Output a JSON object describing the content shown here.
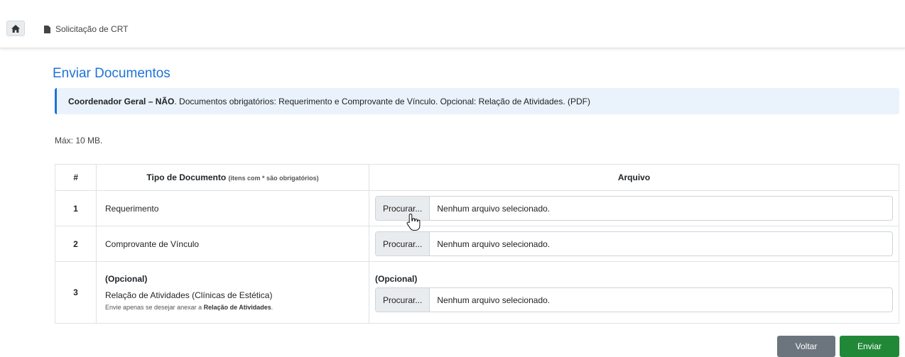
{
  "breadcrumb": {
    "current": "Solicitação de CRT"
  },
  "page": {
    "title": "Enviar Documentos"
  },
  "alert": {
    "bold": "Coordenador Geral – NÃO",
    "text": ". Documentos obrigatórios: Requerimento e Comprovante de Vínculo. Opcional: Relação de Atividades. (PDF)"
  },
  "max_note": "Máx: 10 MB.",
  "table": {
    "headers": {
      "num": "#",
      "type": "Tipo de Documento",
      "type_hint": "(itens com * são obrigatórios)",
      "file": "Arquivo"
    },
    "rows": [
      {
        "num": "1",
        "type": "Requerimento",
        "browse": "Procurar...",
        "file_status": "Nenhum arquivo selecionado."
      },
      {
        "num": "2",
        "type": "Comprovante de Vínculo",
        "browse": "Procurar...",
        "file_status": "Nenhum arquivo selecionado."
      },
      {
        "num": "3",
        "optional_tag": "(Opcional)",
        "type": "Relação de Atividades (Clínicas de Estética)",
        "help_prefix": "Envie apenas se desejar anexar a ",
        "help_bold": "Relação de Atividades",
        "help_suffix": ".",
        "file_optional_tag": "(Opcional)",
        "browse": "Procurar...",
        "file_status": "Nenhum arquivo selecionado."
      }
    ]
  },
  "actions": {
    "back": "Voltar",
    "send": "Enviar"
  },
  "colors": {
    "accent": "#1e73d8",
    "send": "#218838",
    "back": "#6c757d",
    "alert_bg": "#eaf3fc"
  },
  "icons": {
    "home": "home-icon",
    "page": "file-icon",
    "cursor": "hand-pointer-icon"
  }
}
